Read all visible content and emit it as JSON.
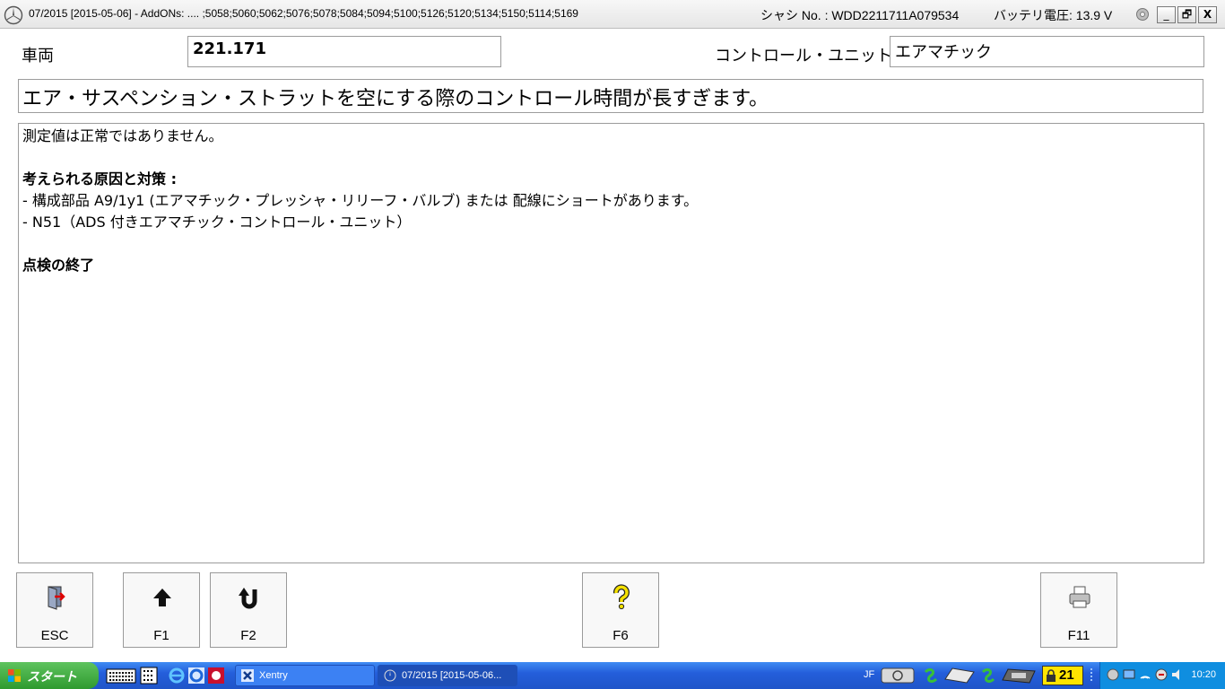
{
  "window": {
    "title": "07/2015 [2015-05-06] - AddONs: .... ;5058;5060;5062;5076;5078;5084;5094;5100;5126;5120;5134;5150;5114;5169",
    "chassis": "シャシ No. : WDD2211711A079534",
    "battery": "バッテリ電圧: 13.9 V",
    "minimize": "_",
    "restore": "🗗",
    "close": "X"
  },
  "vehicle": {
    "label": "車両",
    "value": "221.171"
  },
  "control_unit": {
    "label": "コントロール・ユニット",
    "value": "エアマチック"
  },
  "headline": "エア・サスペンション・ストラットを空にする際のコントロール時間が長すぎます。",
  "detail": {
    "lines": [
      "測定値は正常ではありません。",
      "",
      "考えられる原因と対策 :",
      "- 構成部品 A9/1y1 (エアマチック・プレッシャ・リリーフ・バルブ) または 配線にショートがあります。",
      "- N51（ADS 付きエアマチック・コントロール・ユニット）",
      "",
      "点検の終了"
    ]
  },
  "buttons": {
    "esc": "ESC",
    "f1": "F1",
    "f2": "F2",
    "f6": "F6",
    "f11": "F11"
  },
  "taskbar": {
    "start": "スタート",
    "task_xentry": "Xentry",
    "task_window": "07/2015 [2015-05-06...",
    "lang": "JF",
    "badge_count": "21",
    "clock": "10:20"
  },
  "colors": {
    "taskbar": "#245edb",
    "start": "#2f9a2f",
    "tray": "#0f8ee0",
    "badge": "#ffe400"
  }
}
